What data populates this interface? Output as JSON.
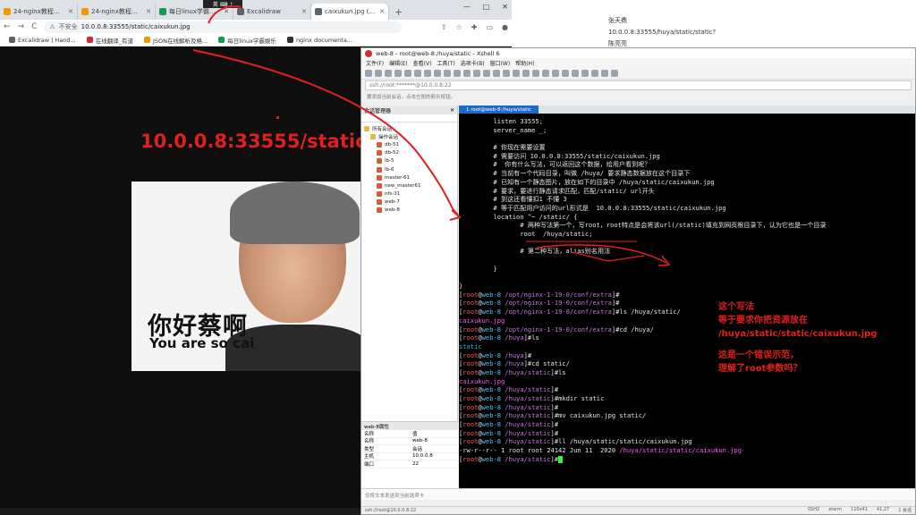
{
  "browser": {
    "tabs": [
      {
        "label": "24-nginx教程篇 - Gi",
        "color": "#f29900",
        "active": false
      },
      {
        "label": "24-nginx教程篇 - Gi",
        "color": "#f29900",
        "active": false
      },
      {
        "label": "每日linux学霸娱乐",
        "color": "#0f9d58",
        "active": false
      },
      {
        "label": "Excalidraw",
        "color": "#5f6368",
        "active": false
      },
      {
        "label": "caixukun.jpg (580×",
        "color": "#5f6368",
        "active": true
      }
    ],
    "new_tab": "+",
    "window_controls": [
      "—",
      "□",
      "✕"
    ],
    "nav": {
      "back": "←",
      "forward": "→",
      "reload": "C"
    },
    "omnibox": {
      "security": "不安全",
      "url": "10.0.0.8:33555/static/caixukun.jpg"
    },
    "bookmarks": [
      {
        "label": "Excalidraw | Hand...",
        "color": "#5f6368"
      },
      {
        "label": "在线翻译_有道",
        "color": "#d9262c"
      },
      {
        "label": "JSON在线解析及格...",
        "color": "#f29900"
      },
      {
        "label": "每日linux学霸娱乐",
        "color": "#0f9d58"
      },
      {
        "label": "nginx documenta...",
        "color": "#333333"
      }
    ],
    "tooltip": "英 ⌨ ♪"
  },
  "meme": {
    "cn_caption": "你好蔡啊",
    "en_caption": "You are so cai"
  },
  "overlay_url": "10.0.0.8:33555/static/",
  "doc": {
    "lines": [
      "张天鼎",
      "10.0.0.8:33555/huya/static/static?",
      "陈亮亮"
    ]
  },
  "xshell": {
    "title": "web-8 - root@web-8:/huya/static - Xshell 6",
    "menu": [
      "文件(F)",
      "编辑(E)",
      "查看(V)",
      "工具(T)",
      "选项卡(B)",
      "窗口(W)",
      "帮助(H)"
    ],
    "address": "ssh://root:*******@10.0.0.8:22",
    "hint": "要添加当前会话，点击左侧的箭头按钮。",
    "sessions_title": "会话管理器",
    "sessions": [
      {
        "label": "所有会话",
        "type": "folder",
        "level": 0
      },
      {
        "label": "操作会话",
        "type": "folder",
        "level": 1
      },
      {
        "label": "db-51",
        "type": "session",
        "level": 1
      },
      {
        "label": "db-52",
        "type": "session",
        "level": 1
      },
      {
        "label": "lb-5",
        "type": "session",
        "level": 1
      },
      {
        "label": "lb-6",
        "type": "session",
        "level": 1
      },
      {
        "label": "master-61",
        "type": "session",
        "level": 1
      },
      {
        "label": "new_master61",
        "type": "session",
        "level": 1
      },
      {
        "label": "nfs-31",
        "type": "session",
        "level": 1
      },
      {
        "label": "web-7",
        "type": "session",
        "level": 1
      },
      {
        "label": "web-8",
        "type": "session",
        "level": 1
      }
    ],
    "props_title": "web-8属性",
    "props": [
      [
        "名称",
        "值"
      ],
      [
        "名称",
        "web-8"
      ],
      [
        "类型",
        "会话"
      ],
      [
        "主机",
        "10.0.0.8"
      ],
      [
        "端口",
        "22"
      ]
    ],
    "terminal_tab": "1 root@web-8:/huya/static",
    "terminal_lines": [
      [
        {
          "t": "         listen 33555;"
        }
      ],
      [
        {
          "t": "         server_name _;"
        }
      ],
      [
        {
          "t": ""
        }
      ],
      [
        {
          "t": "         # 你现在需要设置"
        }
      ],
      [
        {
          "t": "         # 需要访问 10.0.0.8:33555/static/caixukun.jpg"
        }
      ],
      [
        {
          "t": "         #  你有什么写法，可以返回这个数据，给用户看到呢？"
        }
      ],
      [
        {
          "t": "         # 当前有一个代码目录，叫做 /huya/ 要求静态数据放在这个目录下"
        }
      ],
      [
        {
          "t": "         # 已知有一个静态图片，放在如下的目录中 /huya/static/caixukun.jpg"
        }
      ],
      [
        {
          "t": "         # 要求，要进行静态请求匹配，匹配/static/ url开头"
        }
      ],
      [
        {
          "t": "         # 到这还看懂扣1 不懂 3"
        }
      ],
      [
        {
          "t": "         # 等于匹配用户访问的url形式是  10.0.0.8:33555/static/caixukun.jpg"
        }
      ],
      [
        {
          "t": "         location ^~ /static/ {"
        }
      ],
      [
        {
          "t": "                # 两种写法第一个，写root，root特点是会将该url(/static)填充到网页根目录下，认为它也是一个目录"
        }
      ],
      [
        {
          "t": "                root  /huya/static;"
        }
      ],
      [
        {
          "t": ""
        }
      ],
      [
        {
          "t": "                # 第二种写法，alias别名用法"
        }
      ],
      [
        {
          "t": ""
        }
      ],
      [
        {
          "t": "         }"
        }
      ],
      [
        {
          "t": ""
        }
      ],
      [
        {
          "t": "}"
        }
      ],
      [
        {
          "t": "[",
          "c": ""
        },
        {
          "t": "root",
          "c": "p-user"
        },
        {
          "t": "@"
        },
        {
          "t": "web-8",
          "c": "p-host"
        },
        {
          "t": " "
        },
        {
          "t": "/opt/nginx-1-19-0/conf/extra",
          "c": "p-path"
        },
        {
          "t": "]#"
        }
      ],
      [
        {
          "t": "["
        },
        {
          "t": "root",
          "c": "p-user"
        },
        {
          "t": "@"
        },
        {
          "t": "web-8",
          "c": "p-host"
        },
        {
          "t": " "
        },
        {
          "t": "/opt/nginx-1-19-0/conf/extra",
          "c": "p-path"
        },
        {
          "t": "]#"
        }
      ],
      [
        {
          "t": "["
        },
        {
          "t": "root",
          "c": "p-user"
        },
        {
          "t": "@"
        },
        {
          "t": "web-8",
          "c": "p-host"
        },
        {
          "t": " "
        },
        {
          "t": "/opt/nginx-1-19-0/conf/extra",
          "c": "p-path"
        },
        {
          "t": "]#ls /huya/static/"
        }
      ],
      [
        {
          "t": "caixukun.jpg",
          "c": "p-img"
        }
      ],
      [
        {
          "t": "["
        },
        {
          "t": "root",
          "c": "p-user"
        },
        {
          "t": "@"
        },
        {
          "t": "web-8",
          "c": "p-host"
        },
        {
          "t": " "
        },
        {
          "t": "/opt/nginx-1-19-0/conf/extra",
          "c": "p-path"
        },
        {
          "t": "]#cd /huya/"
        }
      ],
      [
        {
          "t": "["
        },
        {
          "t": "root",
          "c": "p-user"
        },
        {
          "t": "@"
        },
        {
          "t": "web-8",
          "c": "p-host"
        },
        {
          "t": " "
        },
        {
          "t": "/huya",
          "c": "p-path"
        },
        {
          "t": "]#ls"
        }
      ],
      [
        {
          "t": "static",
          "c": "p-dir"
        }
      ],
      [
        {
          "t": "["
        },
        {
          "t": "root",
          "c": "p-user"
        },
        {
          "t": "@"
        },
        {
          "t": "web-8",
          "c": "p-host"
        },
        {
          "t": " "
        },
        {
          "t": "/huya",
          "c": "p-path"
        },
        {
          "t": "]#"
        }
      ],
      [
        {
          "t": "["
        },
        {
          "t": "root",
          "c": "p-user"
        },
        {
          "t": "@"
        },
        {
          "t": "web-8",
          "c": "p-host"
        },
        {
          "t": " "
        },
        {
          "t": "/huya",
          "c": "p-path"
        },
        {
          "t": "]#cd static/"
        }
      ],
      [
        {
          "t": "["
        },
        {
          "t": "root",
          "c": "p-user"
        },
        {
          "t": "@"
        },
        {
          "t": "web-8",
          "c": "p-host"
        },
        {
          "t": " "
        },
        {
          "t": "/huya/static",
          "c": "p-path"
        },
        {
          "t": "]#ls"
        }
      ],
      [
        {
          "t": "caixukun.jpg",
          "c": "p-img"
        }
      ],
      [
        {
          "t": "["
        },
        {
          "t": "root",
          "c": "p-user"
        },
        {
          "t": "@"
        },
        {
          "t": "web-8",
          "c": "p-host"
        },
        {
          "t": " "
        },
        {
          "t": "/huya/static",
          "c": "p-path"
        },
        {
          "t": "]#"
        }
      ],
      [
        {
          "t": "["
        },
        {
          "t": "root",
          "c": "p-user"
        },
        {
          "t": "@"
        },
        {
          "t": "web-8",
          "c": "p-host"
        },
        {
          "t": " "
        },
        {
          "t": "/huya/static",
          "c": "p-path"
        },
        {
          "t": "]#mkdir static"
        }
      ],
      [
        {
          "t": "["
        },
        {
          "t": "root",
          "c": "p-user"
        },
        {
          "t": "@"
        },
        {
          "t": "web-8",
          "c": "p-host"
        },
        {
          "t": " "
        },
        {
          "t": "/huya/static",
          "c": "p-path"
        },
        {
          "t": "]#"
        }
      ],
      [
        {
          "t": "["
        },
        {
          "t": "root",
          "c": "p-user"
        },
        {
          "t": "@"
        },
        {
          "t": "web-8",
          "c": "p-host"
        },
        {
          "t": " "
        },
        {
          "t": "/huya/static",
          "c": "p-path"
        },
        {
          "t": "]#mv caixukun.jpg static/"
        }
      ],
      [
        {
          "t": "["
        },
        {
          "t": "root",
          "c": "p-user"
        },
        {
          "t": "@"
        },
        {
          "t": "web-8",
          "c": "p-host"
        },
        {
          "t": " "
        },
        {
          "t": "/huya/static",
          "c": "p-path"
        },
        {
          "t": "]#"
        }
      ],
      [
        {
          "t": "["
        },
        {
          "t": "root",
          "c": "p-user"
        },
        {
          "t": "@"
        },
        {
          "t": "web-8",
          "c": "p-host"
        },
        {
          "t": " "
        },
        {
          "t": "/huya/static",
          "c": "p-path"
        },
        {
          "t": "]#"
        }
      ],
      [
        {
          "t": "["
        },
        {
          "t": "root",
          "c": "p-user"
        },
        {
          "t": "@"
        },
        {
          "t": "web-8",
          "c": "p-host"
        },
        {
          "t": " "
        },
        {
          "t": "/huya/static",
          "c": "p-path"
        },
        {
          "t": "]#ll /huya/static/static/caixukun.jpg"
        }
      ],
      [
        {
          "t": "-rw-r--r-- 1 root root 24142 Jun 11  2020 "
        },
        {
          "t": "/huya/static/static/caixukun.jpg",
          "c": "p-img"
        }
      ],
      [
        {
          "t": "["
        },
        {
          "t": "root",
          "c": "p-user"
        },
        {
          "t": "@"
        },
        {
          "t": "web-8",
          "c": "p-host"
        },
        {
          "t": " "
        },
        {
          "t": "/huya/static",
          "c": "p-path"
        },
        {
          "t": "]#"
        },
        {
          "t": "",
          "c": "cursor"
        }
      ]
    ],
    "annotation1": [
      "这个写法",
      "等于要求你把资源放在",
      "/huya/static/static/caixukun.jpg"
    ],
    "annotation2": [
      "这是一个错误示范，",
      "理解了root参数吗？"
    ],
    "input_hint": "仅将文本发送到当前选项卡",
    "status_left": "ssh://root@10.0.0.8:22",
    "status_right": [
      "SSH2",
      "xterm",
      "110x41",
      "41,27",
      "1 会话"
    ]
  },
  "colors": {
    "accent_red": "#e0201c",
    "terminal_bg": "#000000",
    "xshell_tab": "#1e6ac8"
  }
}
